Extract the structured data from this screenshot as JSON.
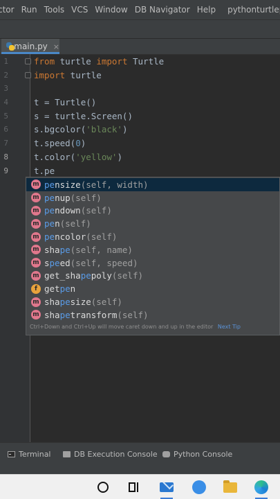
{
  "menu": {
    "items": [
      "ctor",
      "Run",
      "Tools",
      "VCS",
      "Window",
      "DB Navigator",
      "Help"
    ],
    "project_title": "pythonturtleproject"
  },
  "tab": {
    "label": "main.py",
    "close_glyph": "×"
  },
  "editor": {
    "line_numbers": [
      "1",
      "2",
      "3",
      "4",
      "5",
      "6",
      "7",
      "8",
      "9"
    ],
    "current_line": 9,
    "lines": [
      {
        "tokens": [
          {
            "t": "from",
            "c": "kw"
          },
          {
            "t": " turtle ",
            "c": ""
          },
          {
            "t": "import",
            "c": "kw"
          },
          {
            "t": " Turtle",
            "c": ""
          }
        ]
      },
      {
        "tokens": [
          {
            "t": "import",
            "c": "kw"
          },
          {
            "t": " turtle",
            "c": ""
          }
        ]
      },
      {
        "tokens": []
      },
      {
        "tokens": [
          {
            "t": "t = Turtle()",
            "c": ""
          }
        ]
      },
      {
        "tokens": [
          {
            "t": "s = turtle.Screen()",
            "c": ""
          }
        ]
      },
      {
        "tokens": [
          {
            "t": "s.bgcolor(",
            "c": ""
          },
          {
            "t": "'black'",
            "c": "st"
          },
          {
            "t": ")",
            "c": ""
          }
        ]
      },
      {
        "tokens": [
          {
            "t": "t.speed(",
            "c": ""
          },
          {
            "t": "0",
            "c": "nu"
          },
          {
            "t": ")",
            "c": ""
          }
        ]
      },
      {
        "tokens": [
          {
            "t": "t.color(",
            "c": ""
          },
          {
            "t": "'yellow'",
            "c": "st"
          },
          {
            "t": ")",
            "c": ""
          }
        ]
      },
      {
        "tokens": [
          {
            "t": "t.pe",
            "c": ""
          }
        ]
      }
    ]
  },
  "completion": {
    "items": [
      {
        "badge": "m",
        "pre": "",
        "hl": "pe",
        "post": "nsize",
        "sig": "(self, width)"
      },
      {
        "badge": "m",
        "pre": "",
        "hl": "pe",
        "post": "nup",
        "sig": "(self)"
      },
      {
        "badge": "m",
        "pre": "",
        "hl": "pe",
        "post": "ndown",
        "sig": "(self)"
      },
      {
        "badge": "m",
        "pre": "",
        "hl": "pe",
        "post": "n",
        "sig": "(self)"
      },
      {
        "badge": "m",
        "pre": "",
        "hl": "pe",
        "post": "ncolor",
        "sig": "(self)"
      },
      {
        "badge": "m",
        "pre": "sha",
        "hl": "pe",
        "post": "",
        "sig": "(self, name)"
      },
      {
        "badge": "m",
        "pre": "s",
        "hl": "pe",
        "post": "ed",
        "sig": "(self, speed)"
      },
      {
        "badge": "m",
        "pre": "get_sha",
        "hl": "pe",
        "post": "poly",
        "sig": "(self)"
      },
      {
        "badge": "f",
        "pre": "get",
        "hl": "pe",
        "post": "n",
        "sig": ""
      },
      {
        "badge": "m",
        "pre": "sha",
        "hl": "pe",
        "post": "size",
        "sig": "(self)"
      },
      {
        "badge": "m",
        "pre": "sha",
        "hl": "pe",
        "post": "transform",
        "sig": "(self)"
      }
    ],
    "selected_index": 0,
    "hint_text": "Ctrl+Down and Ctrl+Up will move caret down and up in the editor",
    "hint_link": "Next Tip"
  },
  "tool_windows": {
    "terminal": "Terminal",
    "db_console": "DB Execution Console",
    "python_console": "Python Console"
  },
  "taskbar": {
    "icons": [
      "search-icon",
      "task-view-icon",
      "mail-icon",
      "edge-beta-icon",
      "file-explorer-icon",
      "edge-icon"
    ]
  }
}
